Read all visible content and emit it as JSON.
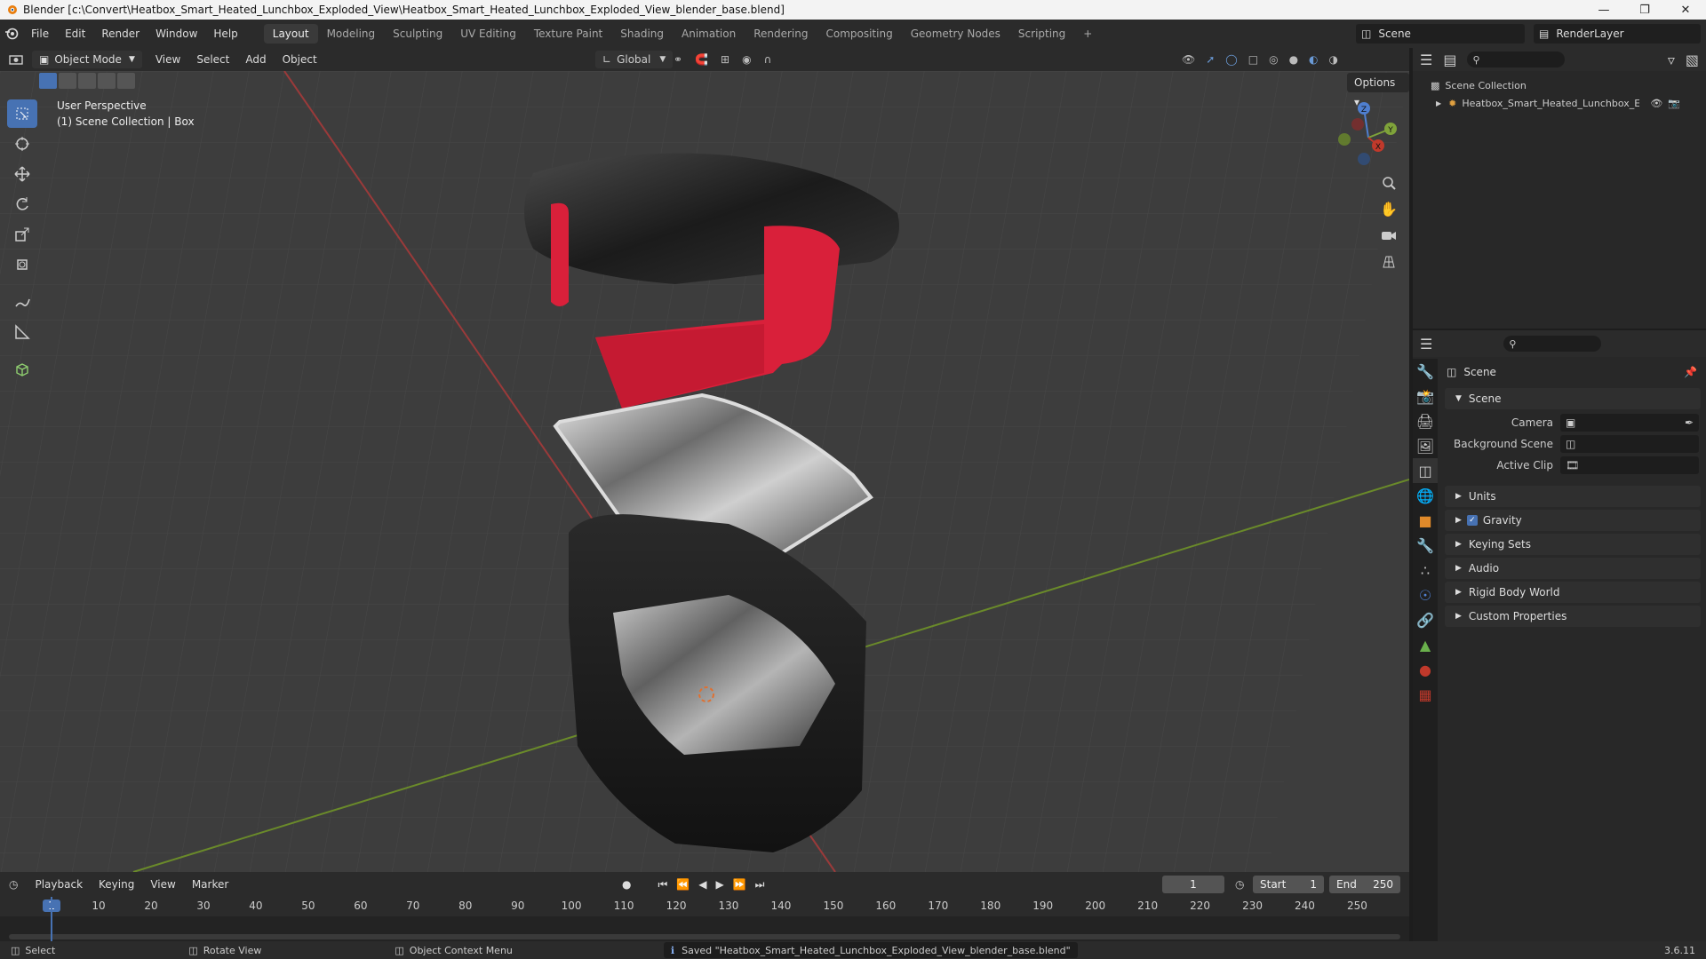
{
  "window": {
    "title": "Blender [c:\\Convert\\Heatbox_Smart_Heated_Lunchbox_Exploded_View\\Heatbox_Smart_Heated_Lunchbox_Exploded_View_blender_base.blend]"
  },
  "menu": [
    "File",
    "Edit",
    "Render",
    "Window",
    "Help"
  ],
  "workspaces": [
    "Layout",
    "Modeling",
    "Sculpting",
    "UV Editing",
    "Texture Paint",
    "Shading",
    "Animation",
    "Rendering",
    "Compositing",
    "Geometry Nodes",
    "Scripting"
  ],
  "scene_name": "Scene",
  "render_layer": "RenderLayer",
  "viewport_header": {
    "mode": "Object Mode",
    "menus": [
      "View",
      "Select",
      "Add",
      "Object"
    ],
    "orientation": "Global",
    "options": "Options"
  },
  "viewport": {
    "perspective": "User Perspective",
    "context": "(1) Scene Collection | Box"
  },
  "gizmo": {
    "x": "X",
    "y": "Y",
    "z": "Z"
  },
  "outliner": {
    "root": "Scene Collection",
    "item": "Heatbox_Smart_Heated_Lunchbox_Expl"
  },
  "properties": {
    "header": "Scene",
    "scene_section": "Scene",
    "rows": [
      {
        "label": "Camera",
        "value": ""
      },
      {
        "label": "Background Scene",
        "value": ""
      },
      {
        "label": "Active Clip",
        "value": ""
      }
    ],
    "sections": [
      "Units",
      "Gravity",
      "Keying Sets",
      "Audio",
      "Rigid Body World",
      "Custom Properties"
    ]
  },
  "timeline": {
    "menus": [
      "Playback",
      "Keying",
      "View",
      "Marker"
    ],
    "current_frame": "1",
    "start_label": "Start",
    "start": "1",
    "end_label": "End",
    "end": "250",
    "ticks": [
      "1",
      "10",
      "20",
      "30",
      "40",
      "50",
      "60",
      "70",
      "80",
      "90",
      "100",
      "110",
      "120",
      "130",
      "140",
      "150",
      "160",
      "170",
      "180",
      "190",
      "200",
      "210",
      "220",
      "230",
      "240",
      "250"
    ]
  },
  "status": {
    "select": "Select",
    "rotate": "Rotate View",
    "context_menu": "Object Context Menu",
    "message": "Saved \"Heatbox_Smart_Heated_Lunchbox_Exploded_View_blender_base.blend\"",
    "version": "3.6.11"
  },
  "colors": {
    "accent": "#4772b3",
    "viewport_bg": "#3d3d3d",
    "lid_red": "#d9203a",
    "x_axis": "#c0392b",
    "y_axis": "#6a9a2a"
  }
}
